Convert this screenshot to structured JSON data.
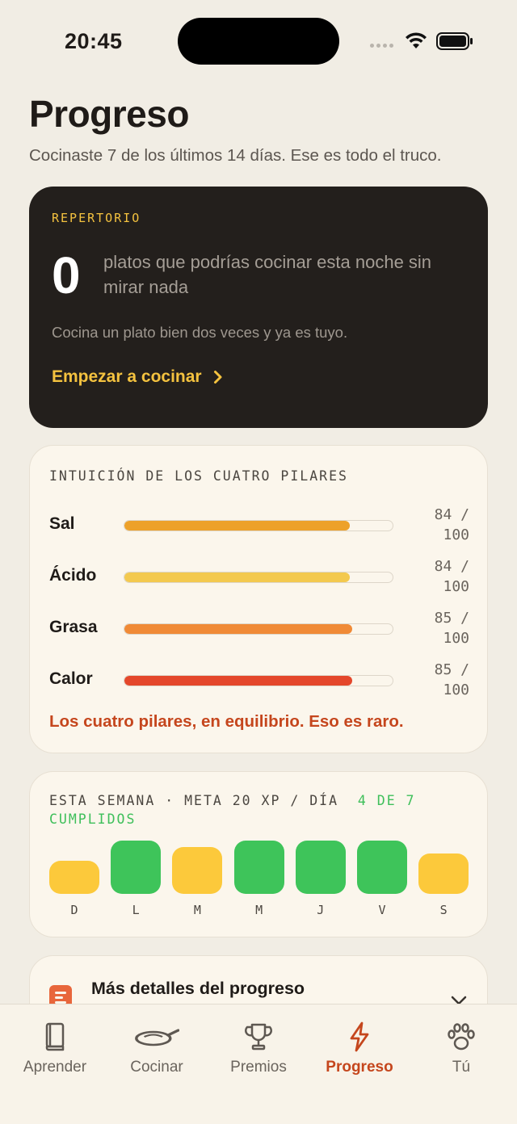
{
  "status_bar": {
    "time": "20:45"
  },
  "header": {
    "title": "Progreso",
    "subtitle": "Cocinaste 7 de los últimos 14 días. Ese es todo el truco."
  },
  "repertoire": {
    "label": "REPERTORIO",
    "count": "0",
    "description": "platos que podrías cocinar esta noche sin mirar nada",
    "hint": "Cocina un plato bien dos veces y ya es tuyo.",
    "cta": "Empezar a cocinar",
    "accent": "#f4c23f"
  },
  "pillars": {
    "title": "INTUICIÓN DE LOS CUATRO PILARES",
    "max": 100,
    "items": [
      {
        "name": "Sal",
        "value": 84,
        "score_line1": "84 /",
        "score_line2": "100",
        "color": "#eda12a"
      },
      {
        "name": "Ácido",
        "value": 84,
        "score_line1": "84 /",
        "score_line2": "100",
        "color": "#f3c94f"
      },
      {
        "name": "Grasa",
        "value": 85,
        "score_line1": "85 /",
        "score_line2": "100",
        "color": "#f08a36"
      },
      {
        "name": "Calor",
        "value": 85,
        "score_line1": "85 /",
        "score_line2": "100",
        "color": "#e4472b"
      }
    ],
    "note": "Los cuatro pilares, en equilibrio. Eso es raro."
  },
  "week": {
    "title": "ESTA SEMANA · META 20 XP / DÍA",
    "done_text": "4 DE 7 CUMPLIDOS",
    "goal_met_color": "#3ec45a",
    "goal_missed_color": "#fcc93b",
    "days": [
      {
        "label": "D",
        "met": false,
        "level": 0.55
      },
      {
        "label": "L",
        "met": true,
        "level": 0.88
      },
      {
        "label": "M",
        "met": false,
        "level": 0.77
      },
      {
        "label": "M",
        "met": true,
        "level": 0.88
      },
      {
        "label": "J",
        "met": true,
        "level": 0.88
      },
      {
        "label": "V",
        "met": true,
        "level": 0.88
      },
      {
        "label": "S",
        "met": false,
        "level": 0.66
      }
    ]
  },
  "details": {
    "title": "Más detalles del progreso"
  },
  "tabs": [
    {
      "label": "Aprender",
      "icon": "book-icon",
      "active": false
    },
    {
      "label": "Cocinar",
      "icon": "pan-icon",
      "active": false
    },
    {
      "label": "Premios",
      "icon": "trophy-icon",
      "active": false
    },
    {
      "label": "Progreso",
      "icon": "bolt-icon",
      "active": true
    },
    {
      "label": "Tú",
      "icon": "paw-icon",
      "active": false
    }
  ]
}
